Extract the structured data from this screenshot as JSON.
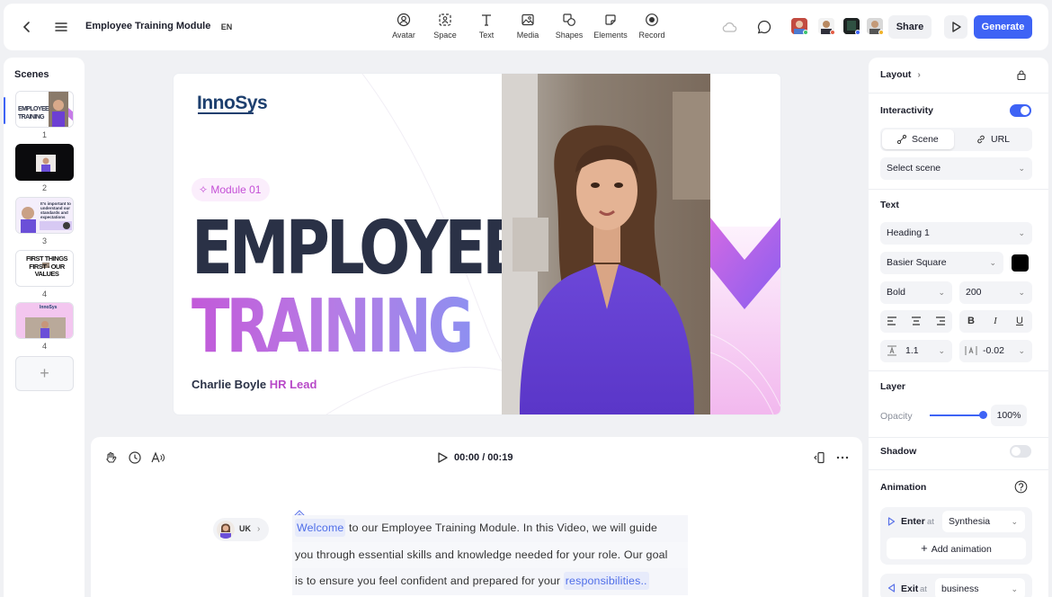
{
  "topbar": {
    "title": "Employee Training Module",
    "lang": "EN",
    "tools": [
      "Avatar",
      "Space",
      "Text",
      "Media",
      "Shapes",
      "Elements",
      "Record"
    ],
    "share_label": "Share",
    "generate_label": "Generate"
  },
  "scenes": {
    "title": "Scenes",
    "items": [
      {
        "num": "1",
        "thumb_text": "EMPLOYEE TRAINING"
      },
      {
        "num": "2"
      },
      {
        "num": "3",
        "thumb_text": "It's important to understand our standards and expectations"
      },
      {
        "num": "4",
        "thumb_text": "FIRST THINGS FIRST - OUR VALUES"
      },
      {
        "num": "4",
        "thumb_text": "InnoSys"
      }
    ],
    "add_label": "+"
  },
  "canvas": {
    "logo": "InnoSys",
    "module": "Module 01",
    "heading_1": "EMPLOYEE",
    "heading_2": "TRAINING",
    "name": "Charlie Boyle",
    "role": "HR Lead"
  },
  "script": {
    "time": "00:00 / 00:19",
    "voice_lang": "UK",
    "word_1": "Welcome",
    "line_1_rest": " to our Employee Training Module. In this Video, we will guide",
    "line_2": "you through essential skills and knowledge needed for your role. Our goal",
    "line_3_start": "is to ensure you feel confident and prepared for your ",
    "word_2": "responsibilities.."
  },
  "props": {
    "layout_label": "Layout",
    "interactivity_label": "Interactivity",
    "interactivity_on": true,
    "seg_scene": "Scene",
    "seg_url": "URL",
    "select_scene": "Select scene",
    "text_label": "Text",
    "text_style": "Heading 1",
    "font": "Basier Square",
    "color": "#000000",
    "weight": "Bold",
    "size": "200",
    "line_height": "1.1",
    "letter_spacing": "-0.02",
    "layer_label": "Layer",
    "opacity_label": "Opacity",
    "opacity_value": "100%",
    "shadow_label": "Shadow",
    "shadow_on": false,
    "animation_label": "Animation",
    "enter_label": "Enter",
    "at_label": "at",
    "enter_value": "Synthesia",
    "add_animation": "Add animation",
    "exit_label": "Exit",
    "exit_value": "business"
  },
  "colors": {
    "accent": "#3e63f5",
    "brand_navy": "#1d3f6e",
    "brand_pink": "#c44fd6"
  }
}
